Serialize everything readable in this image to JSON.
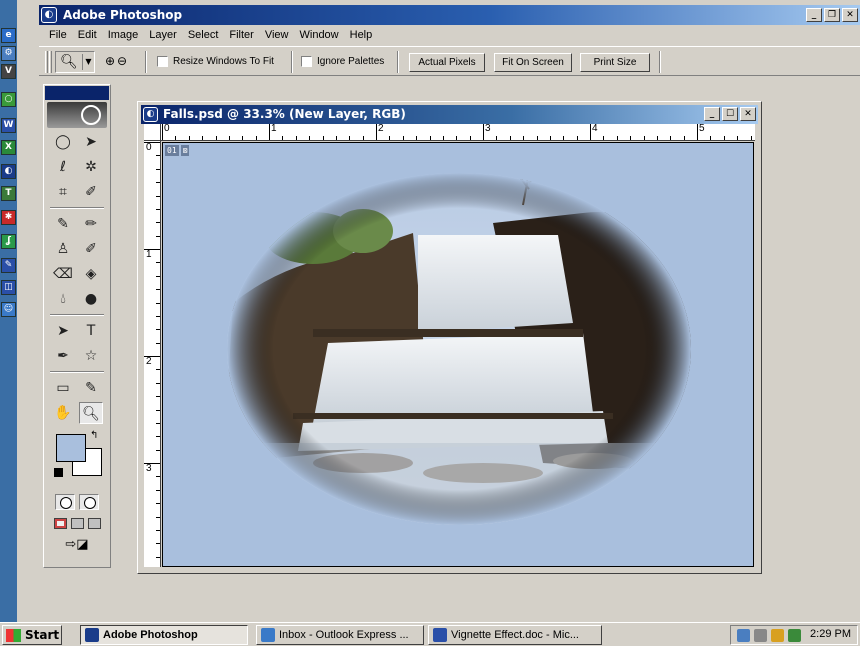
{
  "desktop_quicklaunch": [
    {
      "name": "ie-icon",
      "glyph": "e",
      "color": "#2a6cc8"
    },
    {
      "name": "network-icon",
      "glyph": "⚙",
      "color": "#4a7ec0"
    },
    {
      "name": "vnc-icon",
      "glyph": "V",
      "color": "#444444"
    },
    {
      "name": "app-icon-green",
      "glyph": "○",
      "color": "#3a9a3a"
    },
    {
      "name": "word-icon",
      "glyph": "W",
      "color": "#2a4fa8"
    },
    {
      "name": "excel-icon",
      "glyph": "X",
      "color": "#2a8a3a"
    },
    {
      "name": "photoshop-icon",
      "glyph": "◐",
      "color": "#1a3c8a"
    },
    {
      "name": "pdf-icon",
      "glyph": "T",
      "color": "#3a7a3a"
    },
    {
      "name": "acrobat-icon",
      "glyph": "✱",
      "color": "#c82a2a"
    },
    {
      "name": "dreamweaver-icon",
      "glyph": "ʆ",
      "color": "#2a9a4a"
    },
    {
      "name": "pen-app-icon",
      "glyph": "✎",
      "color": "#2a4fa8"
    },
    {
      "name": "book-icon",
      "glyph": "◫",
      "color": "#2a4fa8"
    },
    {
      "name": "people-icon",
      "glyph": "☺",
      "color": "#3a7ac8"
    }
  ],
  "app": {
    "title": "Adobe Photoshop",
    "menu": [
      "File",
      "Edit",
      "Image",
      "Layer",
      "Select",
      "Filter",
      "View",
      "Window",
      "Help"
    ]
  },
  "options_bar": {
    "resize_windows_label": "Resize Windows To Fit",
    "ignore_palettes_label": "Ignore Palettes",
    "actual_pixels_label": "Actual Pixels",
    "fit_on_screen_label": "Fit On Screen",
    "print_size_label": "Print Size"
  },
  "toolbox": {
    "foreground_color": "#a9bfdd",
    "background_color": "#ffffff"
  },
  "document": {
    "title": "Falls.psd @ 33.3% (New Layer, RGB)",
    "ruler_top_labels": [
      "0",
      "1",
      "2",
      "3",
      "4",
      "5"
    ],
    "ruler_left_labels": [
      "0",
      "1",
      "2",
      "3"
    ],
    "slice_labels": [
      "01",
      "⊠"
    ]
  },
  "taskbar": {
    "start_label": "Start",
    "tasks": [
      {
        "label": "Adobe Photoshop",
        "active": true
      },
      {
        "label": "Inbox - Outlook Express ...",
        "active": false
      },
      {
        "label": "Vignette Effect.doc - Mic...",
        "active": false
      }
    ],
    "clock": "2:29 PM"
  }
}
